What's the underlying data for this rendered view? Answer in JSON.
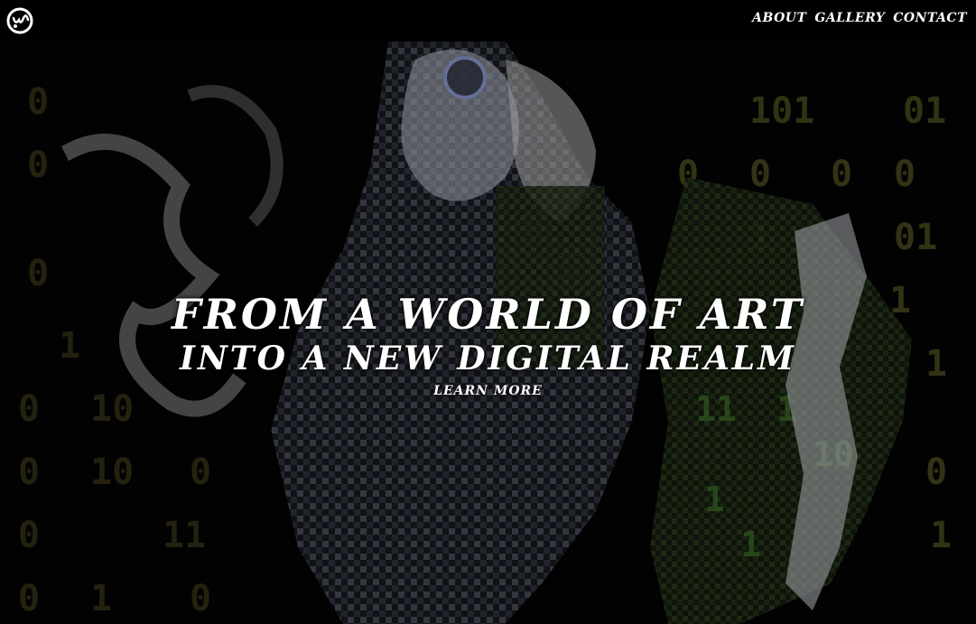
{
  "header": {
    "logo_icon": "swirl-emblem-icon",
    "nav": [
      {
        "label": "ABOUT"
      },
      {
        "label": "GALLERY"
      },
      {
        "label": "CONTACT"
      }
    ]
  },
  "hero": {
    "headline_line1": "FROM A WORLD OF ART",
    "headline_line2": "INTO A NEW DIGITAL REALM",
    "cta_label": "LEARN MORE",
    "binary_digits": [
      "0",
      "1",
      "01",
      "101",
      "10",
      "11"
    ]
  },
  "colors": {
    "background": "#000000",
    "text": "#ffffff",
    "digit_olive": "#4a4a1e",
    "digit_green": "#3e6b2a",
    "accent_blue": "#8a9ad8"
  }
}
